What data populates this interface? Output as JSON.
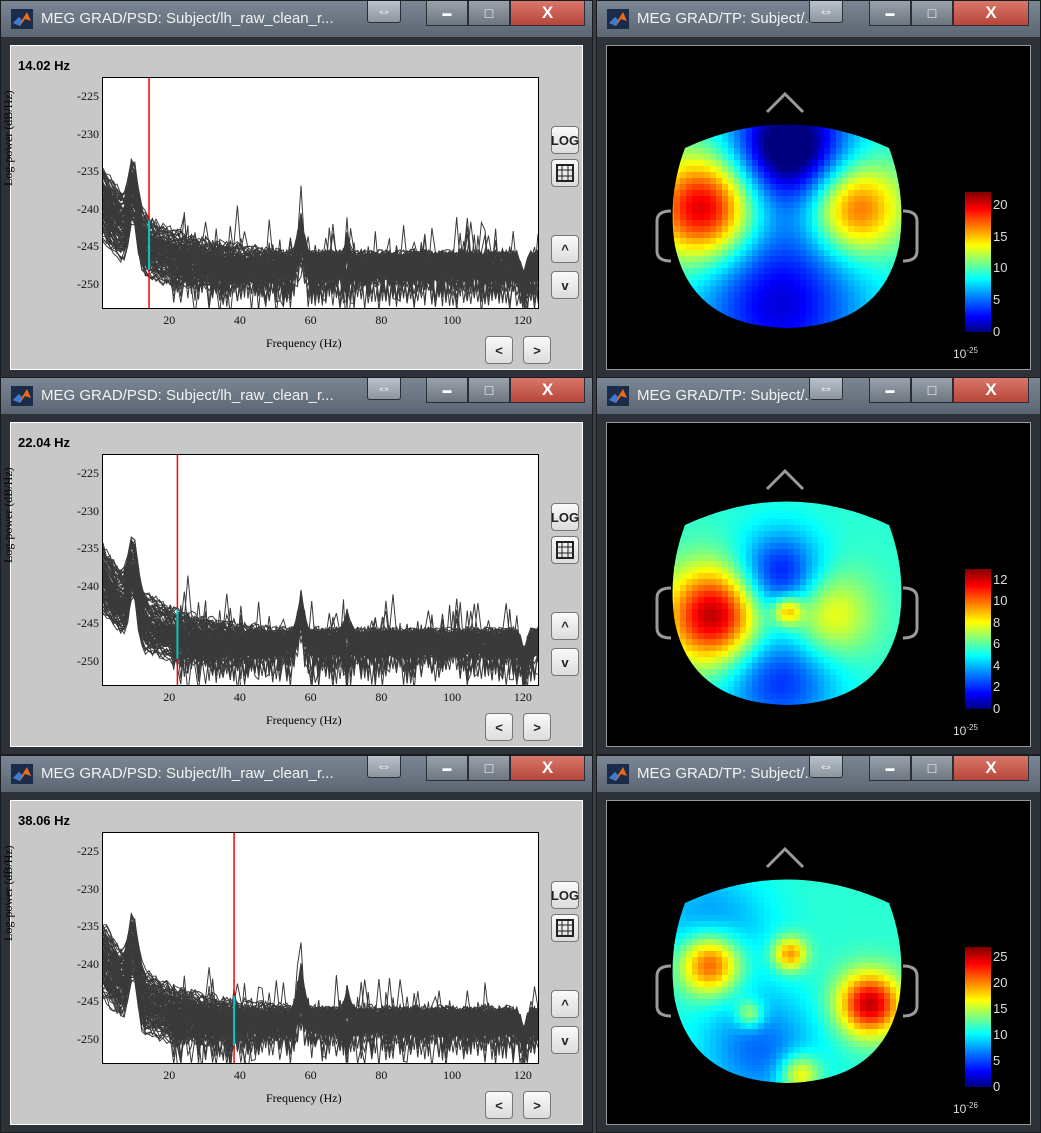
{
  "windows": [
    {
      "title": "MEG GRAD/PSD: Subject/lh_raw_clean_r...",
      "frequency": "14.02 Hz",
      "cursor_hz": 14.02
    },
    {
      "title": "MEG GRAD/PSD: Subject/lh_raw_clean_r...",
      "frequency": "22.04 Hz",
      "cursor_hz": 22.04
    },
    {
      "title": "MEG GRAD/PSD: Subject/lh_raw_clean_r...",
      "frequency": "38.06 Hz",
      "cursor_hz": 38.06
    }
  ],
  "topo_windows": [
    {
      "title": "MEG GRAD/TP: Subject/...",
      "colorbar_ticks": [
        "20",
        "15",
        "10",
        "5",
        "0"
      ],
      "colorbar_max": 22,
      "scale": "10",
      "scale_exp": "-25"
    },
    {
      "title": "MEG GRAD/TP: Subject/...",
      "colorbar_ticks": [
        "12",
        "10",
        "8",
        "6",
        "4",
        "2",
        "0"
      ],
      "colorbar_max": 13,
      "scale": "10",
      "scale_exp": "-25"
    },
    {
      "title": "MEG GRAD/TP: Subject/...",
      "colorbar_ticks": [
        "25",
        "20",
        "15",
        "10",
        "5",
        "0"
      ],
      "colorbar_max": 27,
      "scale": "10",
      "scale_exp": "-26"
    }
  ],
  "plot_axes": {
    "ylabel": "Log-power   (dB/Hz)",
    "xlabel": "Frequency (Hz)",
    "yticks": [
      "-225",
      "-230",
      "-235",
      "-240",
      "-245",
      "-250"
    ],
    "xticks": [
      "20",
      "40",
      "60",
      "80",
      "100",
      "120"
    ]
  },
  "side_buttons": {
    "log": "LOG",
    "grid": "grid-icon",
    "up": "^",
    "down": "v",
    "left": "<",
    "right": ">"
  },
  "window_buttons": {
    "dock": "⇔",
    "minimize": "▬",
    "maximize": "□",
    "close": "X"
  },
  "colors": {
    "trace": "#3a3a3a",
    "cursor": "#ff0000",
    "cursor_fill": "#00c8c8"
  }
}
